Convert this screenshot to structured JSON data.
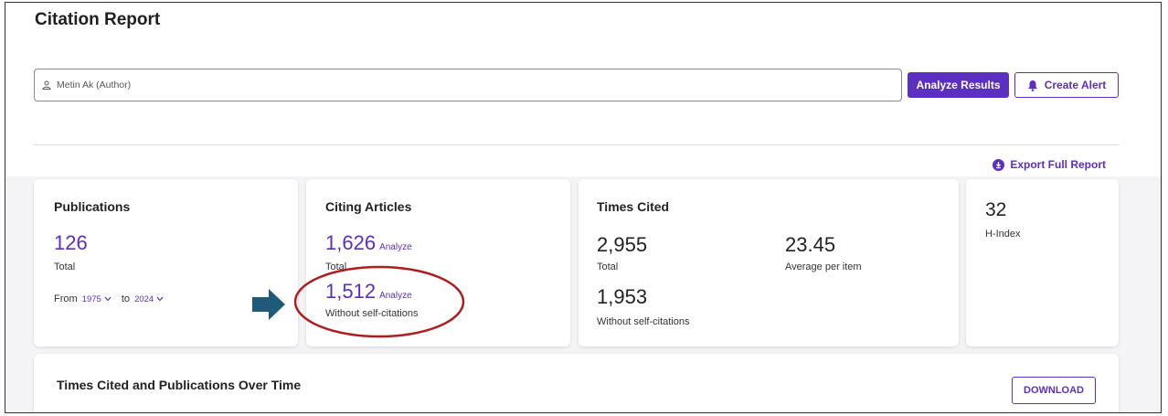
{
  "header": {
    "title": "Citation Report"
  },
  "search": {
    "value": "Metin Ak (Author)"
  },
  "actions": {
    "analyze_results": "Analyze Results",
    "create_alert": "Create Alert",
    "export": "Export Full Report"
  },
  "publications": {
    "heading": "Publications",
    "total": "126",
    "total_label": "Total",
    "from_label": "From",
    "from_year": "1975",
    "to_label": "to",
    "to_year": "2024"
  },
  "citing": {
    "heading": "Citing Articles",
    "total": "1,626",
    "total_link": "Analyze",
    "total_label": "Total",
    "without": "1,512",
    "without_link": "Analyze",
    "without_label": "Without self-citations"
  },
  "times_cited": {
    "heading": "Times Cited",
    "total": "2,955",
    "total_label": "Total",
    "avg": "23.45",
    "avg_label": "Average per item",
    "without": "1,953",
    "without_label": "Without self-citations"
  },
  "h_index": {
    "value": "32",
    "label": "H-Index"
  },
  "chart_section": {
    "title": "Times Cited and Publications Over Time",
    "download": "DOWNLOAD"
  },
  "colors": {
    "accent": "#5b2fbf",
    "annotation_arrow": "#1f5a78",
    "annotation_ellipse": "#b01c1c"
  },
  "icons": {
    "person": "person-icon",
    "bell": "bell-icon",
    "export": "download-circle-icon",
    "chevron": "chevron-down-icon"
  }
}
